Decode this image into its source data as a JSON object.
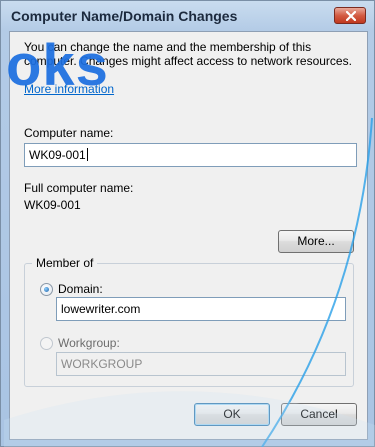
{
  "window": {
    "title": "Computer Name/Domain Changes"
  },
  "description": {
    "line1": "You can change the name and the membership of this",
    "line2": "computer. Changes might affect access to network resources.",
    "more_info_link": "More information"
  },
  "computer_name": {
    "label": "Computer name:",
    "value": "WK09-001"
  },
  "full_computer_name": {
    "label": "Full computer name:",
    "value": "WK09-001"
  },
  "buttons": {
    "more": "More...",
    "ok": "OK",
    "cancel": "Cancel"
  },
  "member_of": {
    "group_label": "Member of",
    "domain": {
      "label": "Domain:",
      "value": "lowewriter.com",
      "selected": true
    },
    "workgroup": {
      "label": "Workgroup:",
      "value": "WORKGROUP",
      "selected": false
    }
  },
  "watermark": {
    "text": "oks"
  },
  "colors": {
    "link": "#0066cc",
    "watermark": "#1d6fe0",
    "close_button": "#c0391f"
  },
  "icons": [
    "close-icon",
    "radio-checked-icon",
    "radio-unchecked-icon"
  ]
}
